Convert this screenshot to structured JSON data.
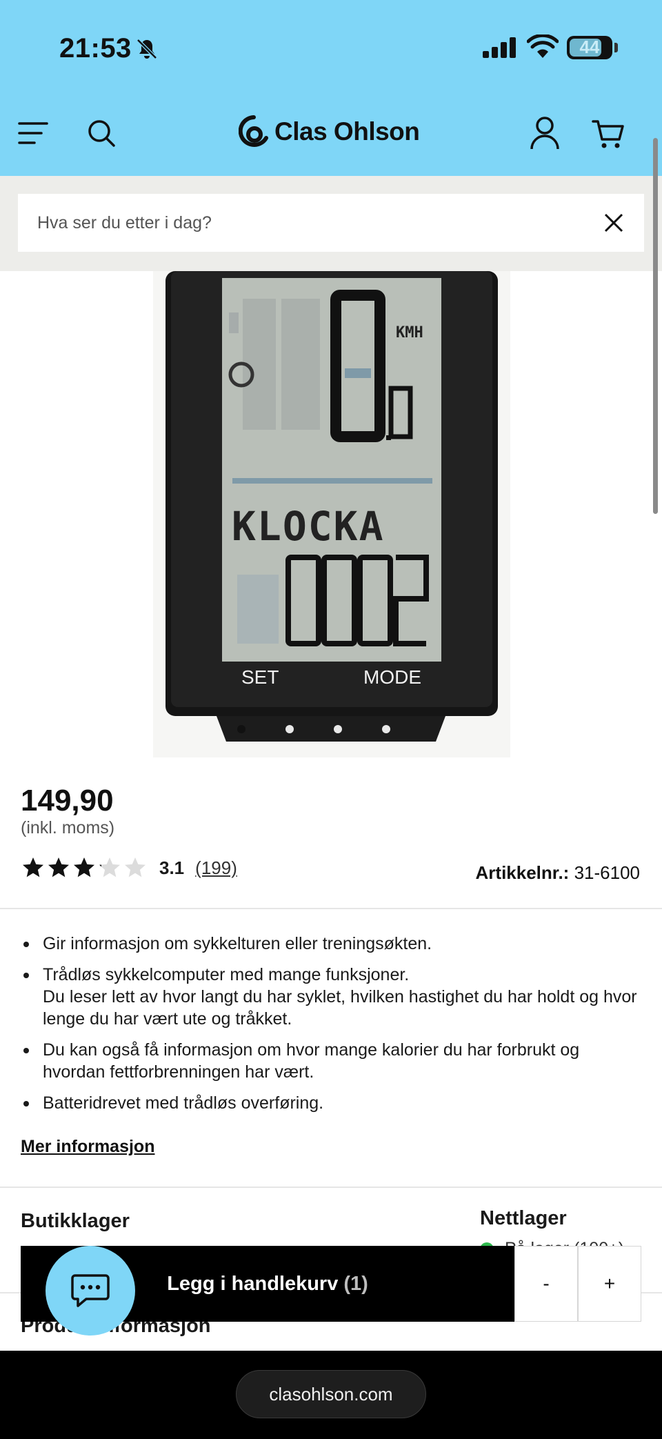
{
  "status_bar": {
    "time": "21:53",
    "battery": "44",
    "icons": [
      "bell-off-icon",
      "signal-icon",
      "wifi-icon",
      "battery-icon"
    ]
  },
  "header": {
    "brand": "Clas Ohlson",
    "icons": [
      "menu-icon",
      "search-icon",
      "account-icon",
      "cart-icon"
    ],
    "accent_color": "#7fd6f7"
  },
  "search": {
    "placeholder": "Hva ser du etter i dag?"
  },
  "product": {
    "image_labels": {
      "set": "SET",
      "mode": "MODE",
      "display_text": "KLOCKA"
    },
    "image_carousel": {
      "count": 4,
      "active": 1
    },
    "price": "149,90",
    "vat_note": "(inkl. moms)",
    "rating": {
      "value": "3.1",
      "count": "(199)",
      "stars_max": 5,
      "score": 3.1
    },
    "article_label": "Artikkelnr.:",
    "article_number": "31-6100",
    "bullets": [
      "Gir informasjon om sykkelturen eller treningsøkten.",
      "Trådløs sykkelcomputer med mange funksjoner.",
      "Du leser lett av hvor langt du har syklet, hvilken hastighet du har holdt og hvor lenge du har vært ute og tråkket.",
      "Du kan også få informasjon om hvor mange kalorier du har forbrukt og hvordan fettforbrenningen har vært.",
      "Batteridrevet med trådløs overføring."
    ],
    "more_info": "Mer informasjon"
  },
  "stock": {
    "store_title": "Butikklager",
    "online_title": "Nettlager",
    "online_status": "På lager (100+)",
    "status_color": "#2db84c"
  },
  "sections": {
    "product_info": "Produktinformasjon"
  },
  "cart_bar": {
    "add_label": "Legg i handlekurv",
    "quantity": "(1)",
    "minus": "-",
    "plus": "+"
  },
  "browser": {
    "url": "clasohlson.com"
  }
}
